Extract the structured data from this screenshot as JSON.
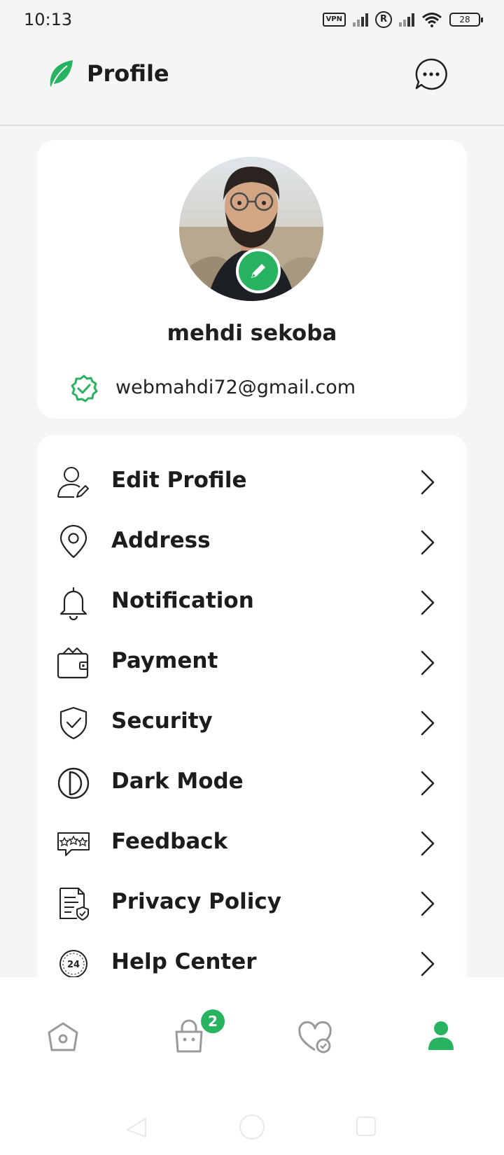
{
  "status_bar": {
    "time": "10:13",
    "vpn": "VPN",
    "battery": "28",
    "icons": [
      "vpn-icon",
      "signal-icon",
      "registered-icon",
      "signal-icon",
      "wifi-icon",
      "battery-icon"
    ]
  },
  "header": {
    "title": "Profile",
    "logo_icon": "leaf-icon",
    "chat_icon": "chat-bubble-icon"
  },
  "profile": {
    "name": "mehdi sekoba",
    "email": "webmahdi72@gmail.com",
    "edit_icon": "pencil-icon",
    "verified_icon": "verified-badge-icon"
  },
  "menu": {
    "items": [
      {
        "label": "Edit Profile",
        "icon": "user-edit-icon"
      },
      {
        "label": "Address",
        "icon": "location-pin-icon"
      },
      {
        "label": "Notification",
        "icon": "bell-icon"
      },
      {
        "label": "Payment",
        "icon": "wallet-icon"
      },
      {
        "label": "Security",
        "icon": "shield-check-icon"
      },
      {
        "label": "Dark Mode",
        "icon": "dark-mode-icon"
      },
      {
        "label": "Feedback",
        "icon": "feedback-stars-icon"
      },
      {
        "label": "Privacy Policy",
        "icon": "document-check-icon"
      },
      {
        "label": "Help Center",
        "icon": "support-24-icon"
      }
    ]
  },
  "help_badge": "24",
  "bottom_nav": {
    "items": [
      "home-icon",
      "shopping-bag-icon",
      "favorites-icon",
      "profile-icon"
    ],
    "active": "profile-icon",
    "cart_count": "2"
  },
  "colors": {
    "accent": "#27b360",
    "background": "#f4f6f5",
    "card": "#ffffff",
    "text": "#1c1c1c"
  }
}
